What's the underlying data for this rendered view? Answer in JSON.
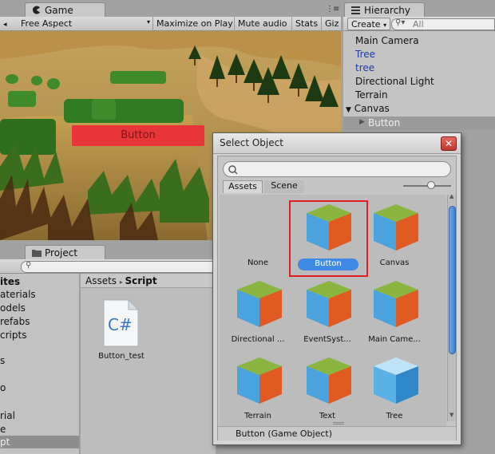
{
  "game": {
    "tab_label": "Game",
    "aspect": "Free Aspect",
    "maximize": "Maximize on Play",
    "mute": "Mute audio",
    "stats": "Stats",
    "gizmos": "Giz",
    "button_label": "Button"
  },
  "hierarchy": {
    "tab_label": "Hierarchy",
    "create": "Create",
    "search_placeholder": "All",
    "items": [
      "Main Camera",
      "Tree",
      "tree",
      "Directional Light",
      "Terrain",
      "Canvas",
      "Button"
    ]
  },
  "project": {
    "tab_label": "Project",
    "sidebar": [
      "ites",
      "aterials",
      "odels",
      "refabs",
      "cripts",
      "s",
      "o",
      "rial",
      "e",
      "pt"
    ],
    "breadcrumb_root": "Assets",
    "breadcrumb_current": "Script",
    "file_name": "Button_test",
    "file_glyph": "C#"
  },
  "dialog": {
    "title": "Select Object",
    "tab_assets": "Assets",
    "tab_scene": "Scene",
    "items": [
      "None",
      "Button",
      "Canvas",
      "Directional ...",
      "EventSyst...",
      "Main Came...",
      "Terrain",
      "Text",
      "Tree"
    ],
    "status": "Button (Game Object)"
  },
  "colors": {
    "ui_button": "#e8353a",
    "selection": "#3e8ae4",
    "highlight_box": "#e02020",
    "cube_top": "#8ab63f",
    "cube_left": "#4ba3de",
    "cube_right": "#e05a22"
  }
}
